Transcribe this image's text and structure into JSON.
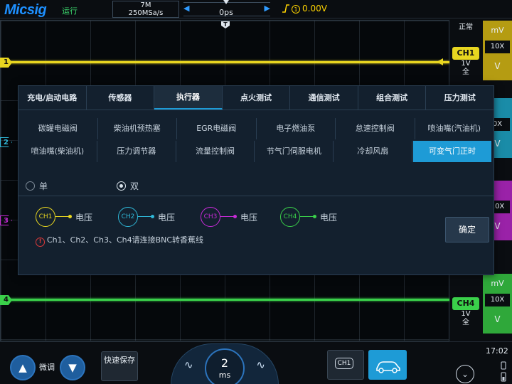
{
  "topbar": {
    "logo": "Micsig",
    "run_status": "运行",
    "memory_depth": "7M",
    "sample_rate": "250MSa/s",
    "timebase_offset": "0ps",
    "trigger_source_icon": "ch1-circle-icon",
    "trigger_level": "0.00V",
    "left_arrow": "◀",
    "right_arrow": "▶"
  },
  "scope": {
    "trigger_position_marker": "T",
    "channel_markers": [
      "1",
      "2",
      "3",
      "4"
    ],
    "colors": {
      "ch1": "#e8d620",
      "ch2": "#2fb8d8",
      "ch3": "#c62bd6",
      "ch4": "#3ad04a",
      "accent": "#1e9bd6"
    }
  },
  "rightpanel": {
    "mode": "正常",
    "ch1": {
      "name": "CH1",
      "scale": "1V",
      "coupling": "全"
    },
    "ch4": {
      "name": "CH4",
      "scale": "1V",
      "coupling": "全"
    },
    "strips": [
      {
        "unit": "mV",
        "probe": "10X",
        "volt": "V"
      },
      {
        "unit": "",
        "probe": "0X",
        "volt": "V"
      },
      {
        "unit": "",
        "probe": "10X",
        "volt": "V"
      },
      {
        "unit": "mV",
        "probe": "10X",
        "volt": "V"
      }
    ]
  },
  "dialog": {
    "tabs": [
      {
        "label": "充电/启动电路"
      },
      {
        "label": "传感器"
      },
      {
        "label": "执行器"
      },
      {
        "label": "点火测试"
      },
      {
        "label": "通信测试"
      },
      {
        "label": "组合测试"
      },
      {
        "label": "压力测试"
      }
    ],
    "active_tab": "执行器",
    "items_row1": [
      "碳罐电磁阀",
      "柴油机预热塞",
      "EGR电磁阀",
      "电子燃油泵",
      "怠速控制阀",
      "喷油嘴(汽油机)"
    ],
    "items_row2": [
      "喷油嘴(柴油机)",
      "压力调节器",
      "流量控制阀",
      "节气门伺服电机",
      "冷却风扇",
      "可变气门正时"
    ],
    "selected_item": "可变气门正时",
    "mode_options": {
      "single": "单",
      "dual": "双",
      "selected": "双"
    },
    "connections": [
      {
        "channel": "CH1",
        "signal": "电压"
      },
      {
        "channel": "CH2",
        "signal": "电压"
      },
      {
        "channel": "CH3",
        "signal": "电压"
      },
      {
        "channel": "CH4",
        "signal": "电压"
      }
    ],
    "note": "Ch1、Ch2、Ch3、Ch4请连接BNC转香蕉线",
    "confirm_label": "确定"
  },
  "bottombar": {
    "fine_label": "微调",
    "quick_save": "快速保存",
    "time_scale_value": "2",
    "time_scale_unit": "ms",
    "channel_button": "CH1",
    "clock": "17:02"
  }
}
